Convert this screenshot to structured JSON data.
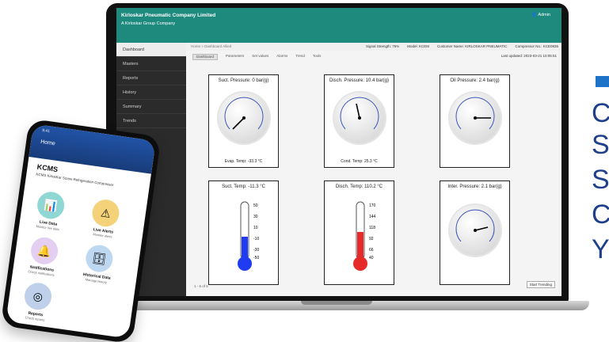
{
  "laptop": {
    "company": "Kirloskar Pneumatic Company Limited",
    "subtitle": "A Kirloskar Group Company",
    "user": "Admin",
    "sidebar": [
      "Dashboard",
      "Masters",
      "Reports",
      "History",
      "Summary",
      "Trends"
    ],
    "breadcrumb": "Home > Dashboard Allied",
    "meta": [
      "Signal Strength: 75%",
      "Model: KCEM",
      "Customer Name: KIRLOSKAR PNEUMATIC",
      "Compressor No.: KCE0836"
    ],
    "tabs": [
      "Dashboard",
      "Parameters",
      "Set values",
      "Alarms",
      "Trend",
      "Tools"
    ],
    "last_updated": "Last updated: 2023-03-21 10:05:51",
    "cards": [
      {
        "title": "Suct. Pressure: 0 bar(g)",
        "foot": "Evap. Temp: -33.3 °C"
      },
      {
        "title": "Disch. Pressure: 10.4 bar(g)",
        "foot": "Cond. Temp: 25.3 °C"
      },
      {
        "title": "Oil Pressure: 2.4 bar(g)",
        "foot": ""
      },
      {
        "title": "Suct. Temp: -11.3 °C",
        "foot": ""
      },
      {
        "title": "Disch. Temp: 110.2 °C",
        "foot": ""
      },
      {
        "title": "Inter. Pressure: 2.1 bar(g)",
        "foot": ""
      }
    ],
    "thermo1_scale": [
      "50",
      "30",
      "10",
      "-10",
      "-30",
      "-50"
    ],
    "thermo2_scale": [
      "170",
      "144",
      "118",
      "92",
      "66",
      "40"
    ],
    "footnote": "1 - 6 of 6",
    "bottom_button": "Start Trending"
  },
  "phone": {
    "status": "9:41",
    "home": "Home",
    "app": "KCMS",
    "app_sub": "KCMS KirlosKar Screw Refrigeration Compressor",
    "tiles": [
      {
        "label": "Live Data",
        "sub": "Monitor live data",
        "color": "#8fd7d3",
        "icon": "chart-icon"
      },
      {
        "label": "Live Alerts",
        "sub": "Monitor alerts",
        "color": "#f3d27a",
        "icon": "alert-icon"
      },
      {
        "label": "Notifications",
        "sub": "Check notifications",
        "color": "#e4cff2",
        "icon": "bell-icon"
      },
      {
        "label": "Historical Data",
        "sub": "Manage history",
        "color": "#bfd8f2",
        "icon": "database-icon"
      },
      {
        "label": "Reports",
        "sub": "Check reports",
        "color": "#bfd1ea",
        "icon": "report-icon"
      }
    ]
  },
  "right_text": [
    "C",
    "S",
    "S",
    "C",
    "Y"
  ]
}
